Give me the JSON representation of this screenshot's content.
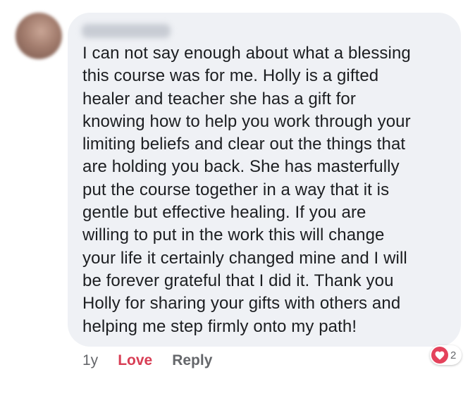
{
  "comment": {
    "author_name": "",
    "text": "I can not say enough about what a blessing\nthis course was for me. Holly is a gifted\nhealer and teacher she has a gift for\nknowing how to help you work through your\nlimiting beliefs and clear out the things that\nare holding you back. She has masterfully\nput the course together in a way that it is\ngentle but effective healing. If you are\nwilling to put in the work this will change\nyour life it certainly changed mine and I will\nbe forever grateful that I did it. Thank you\nHolly for sharing your gifts with others and\nhelping me step firmly onto my path!"
  },
  "actions": {
    "timestamp": "1y",
    "love_label": "Love",
    "reply_label": "Reply"
  },
  "reactions": {
    "icon": "heart-icon",
    "count": "2"
  },
  "colors": {
    "bubble_background": "#eff1f5",
    "text": "#1c1e21",
    "love_accent": "#d83e55",
    "muted": "#65676b"
  }
}
